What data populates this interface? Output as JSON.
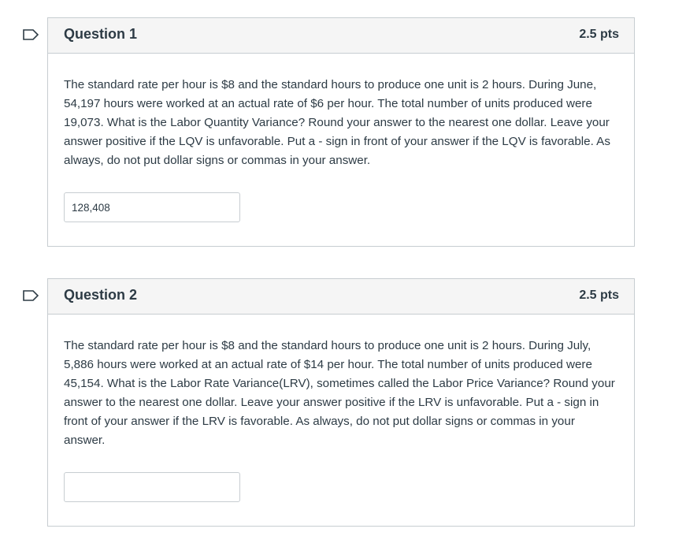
{
  "questions": [
    {
      "title": "Question 1",
      "points": "2.5 pts",
      "text": "The standard rate per hour is $8 and the standard hours to produce one unit is 2 hours. During June, 54,197 hours were worked at an actual rate of $6 per hour. The total number of units produced were 19,073. What is the Labor Quantity Variance? Round your answer to the nearest one dollar. Leave your answer positive if the LQV is unfavorable. Put a - sign in front of your answer if the LQV is favorable. As always, do not put dollar signs or commas in your answer.",
      "answer_value": "128,408",
      "flag_icon": "flag-outline-icon"
    },
    {
      "title": "Question 2",
      "points": "2.5 pts",
      "text": "The standard rate per hour is $8 and the standard hours to produce one unit is 2 hours. During July, 5,886 hours were worked at an actual rate of $14 per hour. The total number of units produced were 45,154. What is the Labor Rate Variance(LRV), sometimes called the Labor Price Variance? Round your answer to the nearest one dollar. Leave your answer positive if the LRV is unfavorable. Put a - sign in front of your answer if the LRV is favorable. As always, do not put dollar signs or commas in your answer.",
      "answer_value": "",
      "flag_icon": "flag-outline-icon"
    }
  ],
  "colors": {
    "text": "#2d3b45",
    "border": "#c7cdd1",
    "header_bg": "#f5f5f5"
  }
}
